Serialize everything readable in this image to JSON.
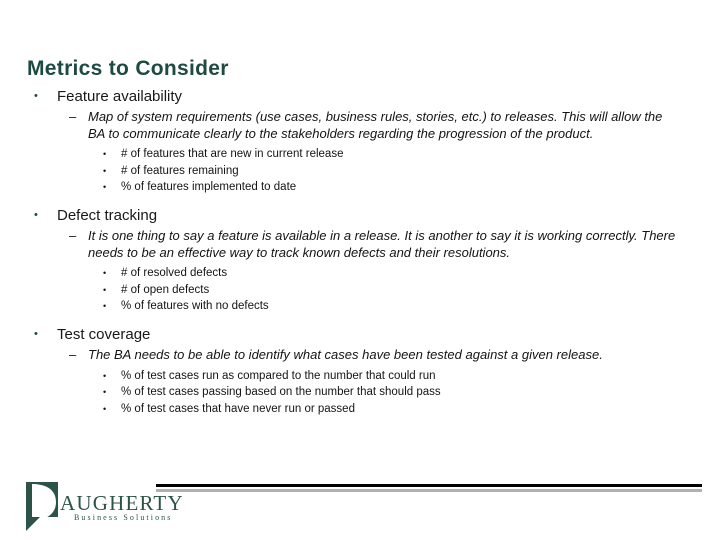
{
  "slide": {
    "title": "Metrics to Consider",
    "title_color": "#1f4a44",
    "sections": [
      {
        "heading": "Feature availability",
        "description": "Map of system requirements (use cases, business rules, stories, etc.) to releases.  This will allow the BA to communicate clearly to the stakeholders regarding the progression of the product.",
        "metrics": [
          "# of features that are new in current release",
          "# of features remaining",
          "% of features implemented to date"
        ]
      },
      {
        "heading": "Defect tracking",
        "description": "It is one thing to say a feature is available in a release.  It is another to say it is working correctly.  There needs to be an effective way to track known defects and their resolutions.",
        "metrics": [
          "# of resolved defects",
          "# of open defects",
          "% of features with no defects"
        ]
      },
      {
        "heading": "Test coverage",
        "description": "The BA needs to be able to identify what cases have been tested against a given release.",
        "metrics": [
          "% of test cases run as compared to the number that could run",
          "% of test cases passing based on the number that should pass",
          "% of test cases that have never run or passed"
        ]
      }
    ],
    "bullet_glyph_level1": "•",
    "bullet_glyph_level2": "–",
    "bullet_glyph_level3": "•"
  },
  "footer": {
    "logo": {
      "name": "daugherty-business-solutions-logo",
      "wordmark": "AUGHERTY",
      "tagline": "Business Solutions",
      "mark_letter": "D",
      "brand_color": "#2d5349"
    },
    "rule_black_color": "#000000",
    "rule_gray_color": "#b0b0b0"
  }
}
